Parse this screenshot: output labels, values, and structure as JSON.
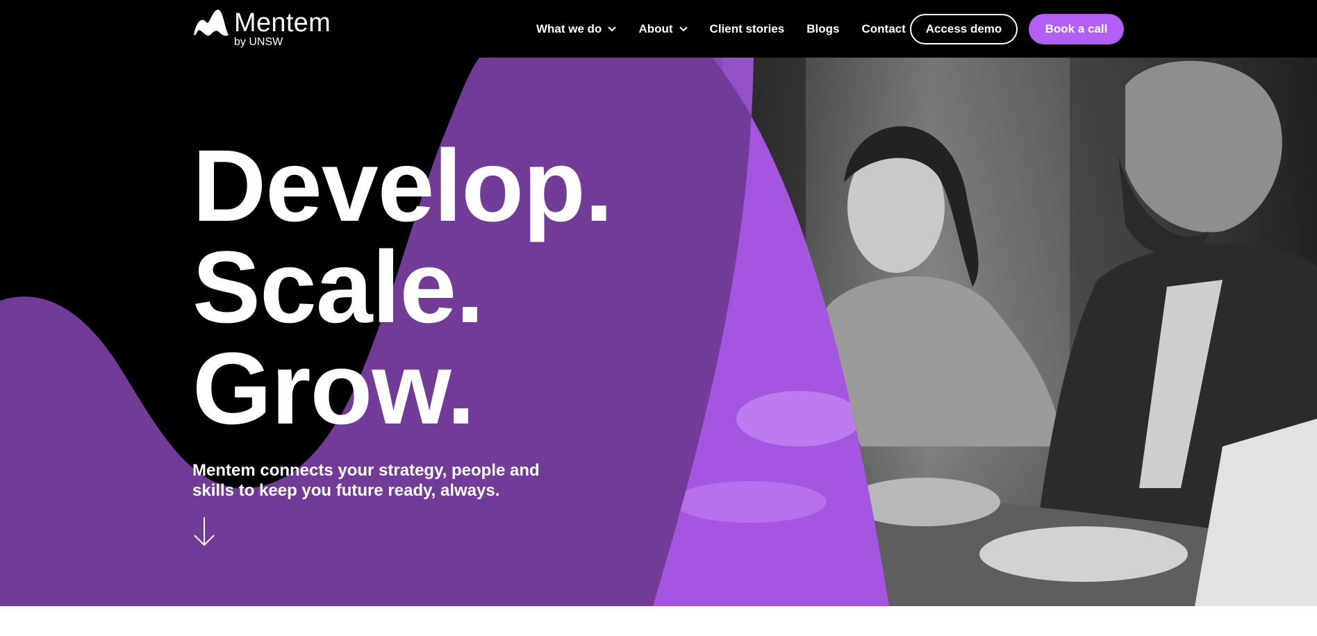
{
  "brand": {
    "name": "Mentem",
    "sub": "by UNSW",
    "logo_icon": "mentem-wave-icon"
  },
  "nav": {
    "items": [
      {
        "label": "What we do",
        "dropdown": true
      },
      {
        "label": "About",
        "dropdown": true
      },
      {
        "label": "Client stories",
        "dropdown": false
      },
      {
        "label": "Blogs",
        "dropdown": false
      },
      {
        "label": "Contact",
        "dropdown": false
      }
    ],
    "access_demo": "Access demo",
    "book_call": "Book a call"
  },
  "hero": {
    "headline": [
      "Develop.",
      "Scale.",
      "Grow."
    ],
    "subtext": "Mentem connects your strategy, people and skills to keep you future ready, always.",
    "scroll_icon": "arrow-down-icon",
    "photo_icon": "meeting-photo"
  },
  "colors": {
    "background": "#000000",
    "purple_dark": "#713b97",
    "purple_bright": "#b35ef5",
    "text": "#ffffff"
  }
}
